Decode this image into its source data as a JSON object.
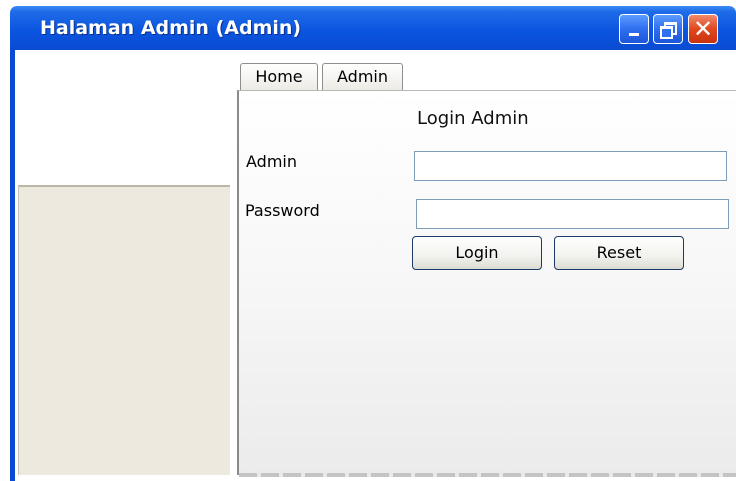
{
  "window": {
    "title": "Halaman Admin (Admin)",
    "controls": {
      "minimize_icon": "minimize-icon",
      "maximize_icon": "restore-icon",
      "close_symbol": "✕"
    }
  },
  "tabs": [
    {
      "label": "Home"
    },
    {
      "label": "Admin"
    }
  ],
  "form": {
    "title": "Login Admin",
    "admin_label": "Admin",
    "admin_value": "",
    "password_label": "Password",
    "password_value": "",
    "login_label": "Login",
    "reset_label": "Reset"
  },
  "colors": {
    "titlebar": "#0b55e0",
    "close_button": "#e0481f",
    "sidebar": "#ede9df",
    "input_border": "#7f9db9"
  }
}
